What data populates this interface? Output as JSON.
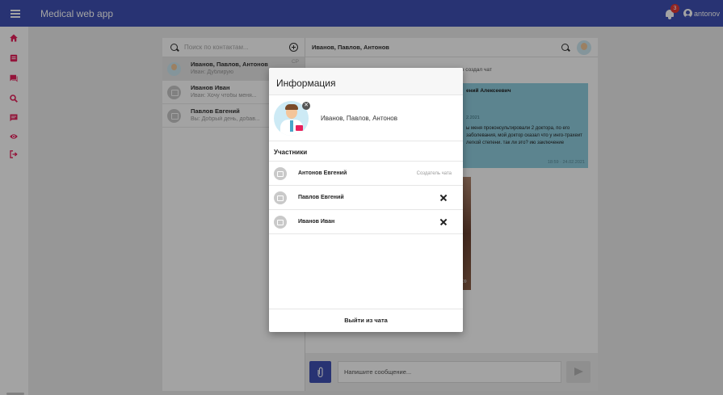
{
  "appbar": {
    "title": "Medical web app",
    "notifications_count": "3",
    "username": "antonov"
  },
  "colors": {
    "primary": "#3f51b5",
    "accent": "#e8205b",
    "chat_bubble": "#91cfe0"
  },
  "leftnav": {
    "items": [
      {
        "icon": "home-icon"
      },
      {
        "icon": "contacts-card-icon"
      },
      {
        "icon": "chat-icon"
      },
      {
        "icon": "search-icon"
      },
      {
        "icon": "message-icon"
      },
      {
        "icon": "eye-icon"
      },
      {
        "icon": "logout-icon"
      }
    ]
  },
  "contacts": {
    "search_placeholder": "Поиск по контактам...",
    "items": [
      {
        "name": "Иванов, Павлов, Антонов",
        "last_message": "Иван: Дублирую",
        "badge": "СР"
      },
      {
        "name": "Иванов Иван",
        "last_message": "Иван: Хочу чтобы меня..."
      },
      {
        "name": "Павлов Евгений",
        "last_message": "Вы: Добрый день, добав..."
      }
    ]
  },
  "chat": {
    "title": "Иванов, Павлов, Антонов",
    "system_message": "вич создал чат",
    "bubble": {
      "author": "ений Алексеевич",
      "date": "2.2021",
      "text": "ы меня проконсультировали 2 доктора, по его заболевания, мой доктор сказал что у инго-трахеит легкой степени. так ли это? ию заключение",
      "time": "18:59 · 24.02.2021"
    },
    "photo_time": "09",
    "input_placeholder": "Напишите сообщение..."
  },
  "dialog": {
    "title": "Информация",
    "group_name": "Иванов, Павлов, Антонов",
    "remove_avatar_glyph": "✕",
    "participants_heading": "Участники",
    "members": [
      {
        "name": "Антонов Евгений",
        "role": "Создатель чата"
      },
      {
        "name": "Павлов Евгений"
      },
      {
        "name": "Иванов Иван"
      }
    ],
    "leave_label": "Выйти из чата"
  }
}
